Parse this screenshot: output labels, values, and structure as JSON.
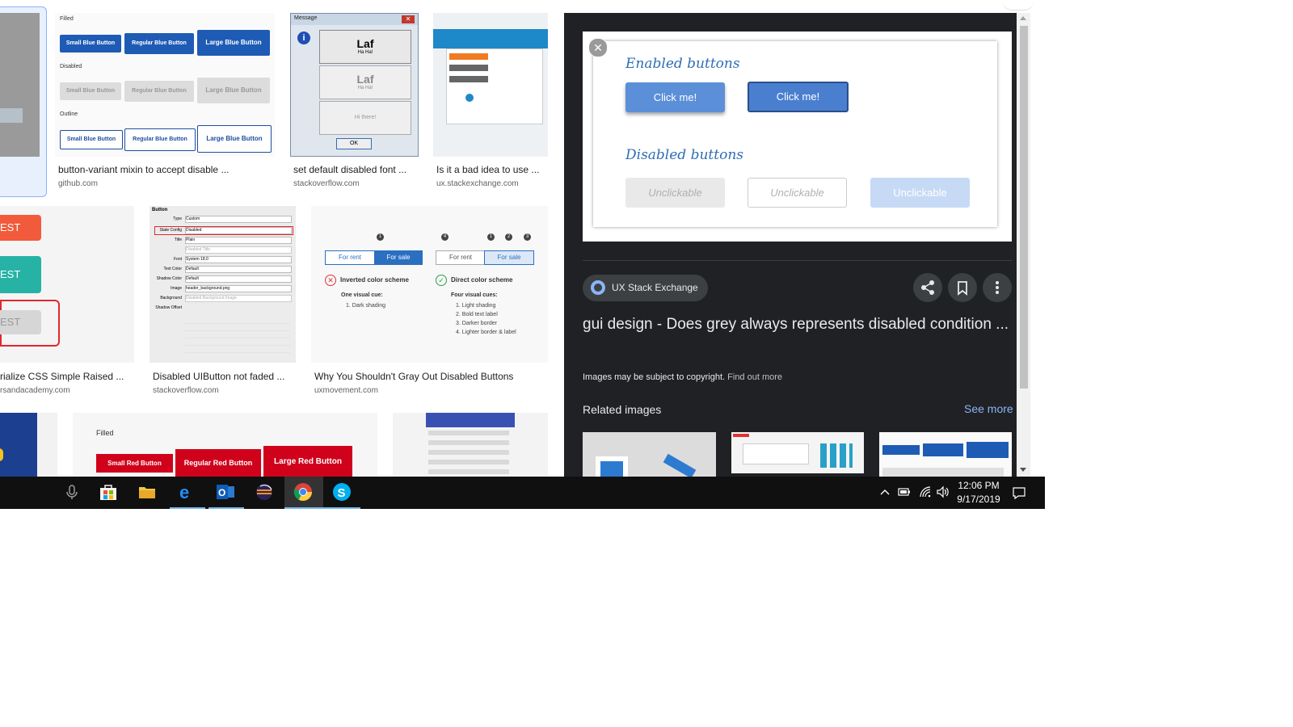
{
  "results": [
    {
      "caption": "button-variant mixin to accept disable ...",
      "source": "github.com"
    },
    {
      "caption": "set default disabled font ...",
      "source": "stackoverflow.com"
    },
    {
      "caption": "Is it a bad idea to use ...",
      "source": "ux.stackexchange.com"
    },
    {
      "caption": "rialize CSS Simple Raised ...",
      "source": "rsandacademy.com"
    },
    {
      "caption": "Disabled UIButton not faded ...",
      "source": "stackoverflow.com"
    },
    {
      "caption": "Why You Shouldn't Gray Out Disabled Buttons",
      "source": "uxmovement.com"
    }
  ],
  "thumb_filled": {
    "section_filled": "Filled",
    "section_disabled": "Disabled",
    "section_outline": "Outline",
    "small": "Small Blue Button",
    "regular": "Regular Blue Button",
    "large": "Large Blue Button"
  },
  "thumb_message": {
    "title": "Message",
    "btn1": "Laf",
    "sub1": "Ha Ha!",
    "btn2": "Laf",
    "sub2": "Ha Ha!",
    "btn3": "Hi there!",
    "ok": "OK"
  },
  "thumb_test": {
    "label": "EST"
  },
  "thumb_ios": {
    "header": "Button",
    "rows": [
      "Type",
      "State Config",
      "Title",
      "",
      "Font",
      "Text Color",
      "Shadow Color",
      "Image",
      "Background",
      "Shadow Offset"
    ],
    "values": [
      "Custom",
      "Disabled",
      "Plain",
      "Disabled Title",
      "System 18.0",
      "Default",
      "Default",
      "header_background.png",
      "Disabled Background Image",
      ""
    ]
  },
  "thumb_rent": {
    "for_rent": "For rent",
    "for_sale": "For sale",
    "inverted_title": "Inverted color scheme",
    "inverted_sub": "One visual cue:",
    "inverted_items": [
      "1. Dark shading"
    ],
    "direct_title": "Direct color scheme",
    "direct_sub": "Four visual cues:",
    "direct_items": [
      "1. Light shading",
      "2. Bold text label",
      "3. Darker border",
      "4. Lighter border & label"
    ],
    "markers": [
      "1",
      "4",
      "1",
      "2",
      "3"
    ]
  },
  "thumb_red": {
    "filled": "Filled",
    "small": "Small Red Button",
    "regular": "Regular Red Button",
    "large": "Large Red Button"
  },
  "preview": {
    "enabled_heading": "Enabled buttons",
    "enabled_btn1": "Click me!",
    "enabled_btn2": "Click me!",
    "disabled_heading": "Disabled buttons",
    "disabled_btn1": "Unclickable",
    "disabled_btn2": "Unclickable",
    "disabled_btn3": "Unclickable"
  },
  "panel": {
    "source_name": "UX Stack Exchange",
    "title": "gui design - Does grey always represents disabled condition ...",
    "copyright": "Images may be subject to copyright.",
    "find_out_more": "Find out more",
    "related": "Related images",
    "see_more": "See more"
  },
  "taskbar": {
    "time": "12:06 PM",
    "date": "9/17/2019",
    "icons": [
      "microphone-icon",
      "store-icon",
      "file-explorer-icon",
      "edge-icon",
      "outlook-icon",
      "eclipse-icon",
      "chrome-icon",
      "skype-icon"
    ]
  },
  "colors": {
    "panel_bg": "#202124",
    "taskbar_bg": "#101010",
    "blue_btn": "#4a86d8",
    "red_btn": "#d0021b"
  }
}
